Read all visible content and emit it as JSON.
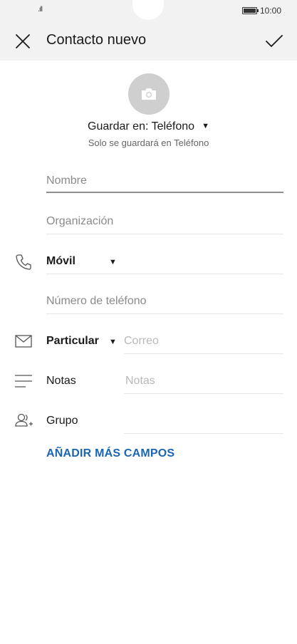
{
  "status_bar": {
    "signal": ".ıll",
    "time": "10:00"
  },
  "header": {
    "title": "Contacto nuevo"
  },
  "save_location": {
    "label": "Guardar en: Teléfono",
    "note": "Solo se guardará en Teléfono"
  },
  "fields": {
    "name_placeholder": "Nombre",
    "organization_placeholder": "Organización",
    "phone_type": "Móvil",
    "phone_placeholder": "Número de teléfono",
    "email_type": "Particular",
    "email_placeholder": "Correo",
    "notes_label": "Notas",
    "notes_placeholder": "Notas",
    "group_label": "Grupo"
  },
  "actions": {
    "add_more_fields": "AÑADIR MÁS CAMPOS"
  },
  "colors": {
    "accent": "#1a66b3",
    "header_bg": "#f2f2f2",
    "avatar_bg": "#cfcfcf"
  },
  "icons": [
    "close-icon",
    "check-icon",
    "camera-icon",
    "phone-icon",
    "mail-icon",
    "notes-icon",
    "group-icon",
    "dropdown-arrow-icon"
  ]
}
